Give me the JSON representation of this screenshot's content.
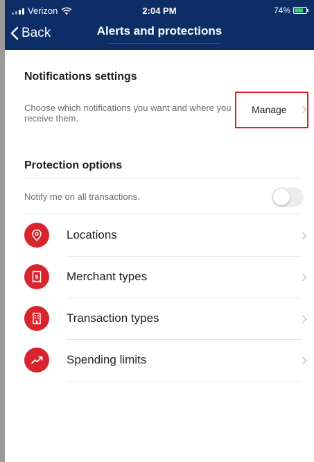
{
  "status_bar": {
    "carrier": "Verizon",
    "time": "2:04 PM",
    "battery": "74%",
    "battery_level": 0.74
  },
  "nav": {
    "back_label": "Back",
    "title": "Alerts and protections"
  },
  "notifications": {
    "heading": "Notifications settings",
    "description": "Choose which notifications you want and where you receive them.",
    "manage_label": "Manage"
  },
  "protection": {
    "heading": "Protection options",
    "toggle_label": "Notify me on all transactions.",
    "toggle_on": false,
    "items": [
      {
        "label": "Locations",
        "icon": "location-pin-icon"
      },
      {
        "label": "Merchant types",
        "icon": "receipt-icon"
      },
      {
        "label": "Transaction types",
        "icon": "building-icon"
      },
      {
        "label": "Spending limits",
        "icon": "trend-up-icon"
      }
    ]
  },
  "colors": {
    "header_bg": "#0c2d66",
    "accent_red": "#d9232d",
    "highlight_red": "#e31a2a"
  }
}
